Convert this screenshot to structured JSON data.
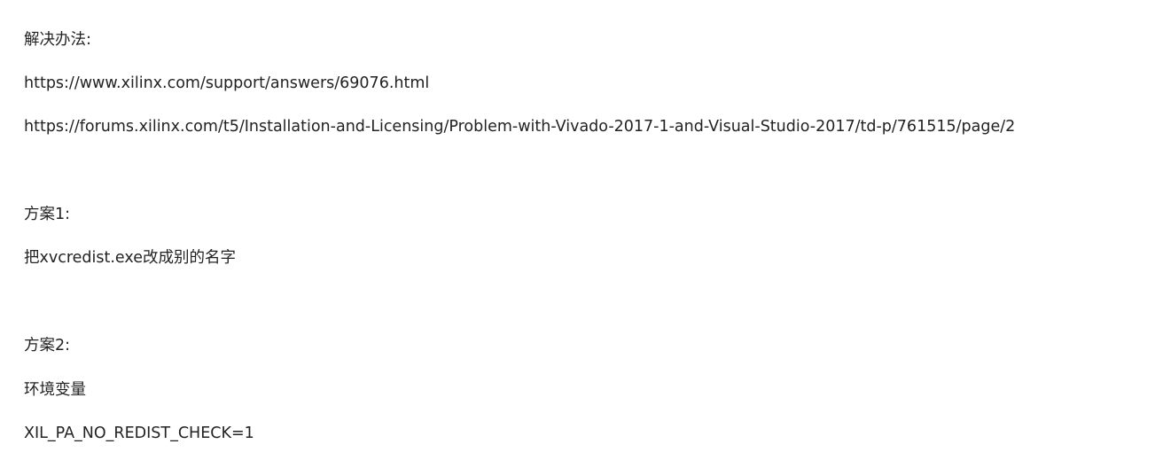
{
  "article": {
    "solution_heading": "解决办法:",
    "links": [
      "https://www.xilinx.com/support/answers/69076.html",
      "https://forums.xilinx.com/t5/Installation-and-Licensing/Problem-with-Vivado-2017-1-and-Visual-Studio-2017/td-p/761515/page/2"
    ],
    "plan1_heading": "方案1:",
    "plan1_text": "把xvcredist.exe改成别的名字",
    "plan2_heading": "方案2:",
    "plan2_text": "环境变量",
    "plan2_code": "XIL_PA_NO_REDIST_CHECK=1"
  }
}
